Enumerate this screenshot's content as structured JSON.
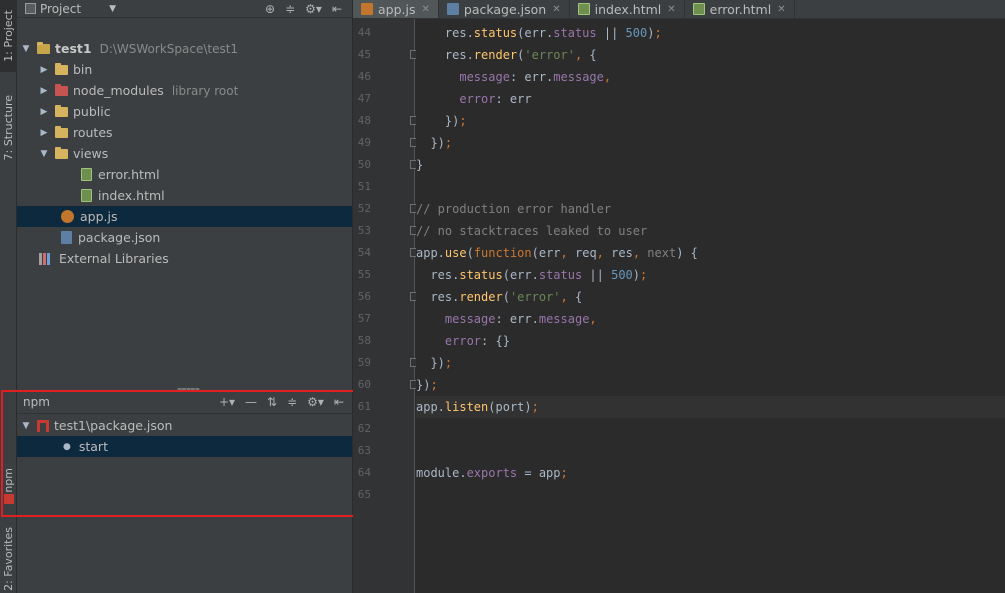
{
  "left_strip": {
    "project_tab": "1: Project",
    "structure_tab": "7: Structure",
    "npm_tab": "npm",
    "favorites_tab": "2: Favorites"
  },
  "project_panel": {
    "title": "Project",
    "tree": [
      {
        "name": "test1",
        "path": "D:\\WSWorkSpace\\test1"
      },
      {
        "name": "bin"
      },
      {
        "name": "node_modules",
        "path": "library root"
      },
      {
        "name": "public"
      },
      {
        "name": "routes"
      },
      {
        "name": "views"
      },
      {
        "name": "error.html"
      },
      {
        "name": "index.html"
      },
      {
        "name": "app.js"
      },
      {
        "name": "package.json"
      },
      {
        "name": "External Libraries"
      }
    ]
  },
  "npm_panel": {
    "title": "npm",
    "package": "test1\\package.json",
    "script": "start"
  },
  "editor": {
    "tabs": [
      {
        "label": "app.js"
      },
      {
        "label": "package.json"
      },
      {
        "label": "index.html"
      },
      {
        "label": "error.html"
      }
    ],
    "line_numbers": [
      "44",
      "45",
      "46",
      "47",
      "48",
      "49",
      "50",
      "51",
      "52",
      "53",
      "54",
      "55",
      "56",
      "57",
      "58",
      "59",
      "60",
      "61",
      "62",
      "63",
      "64",
      "65"
    ]
  }
}
